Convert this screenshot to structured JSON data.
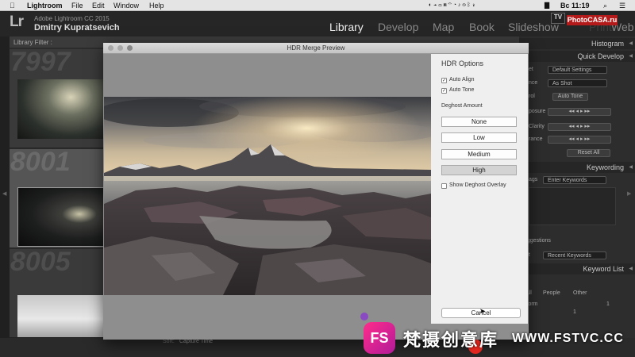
{
  "menubar": {
    "app": "Lightroom",
    "items": [
      "File",
      "Edit",
      "Window",
      "Help"
    ],
    "clock": "Вс 11:19",
    "flag_icon": "us-flag-icon"
  },
  "identity": {
    "logo": "Lr",
    "app_title": "Adobe Lightroom CC 2015",
    "user": "Dmitry Kupratsevich",
    "modules": [
      "Library",
      "Develop",
      "Map",
      "Book",
      "Slideshow",
      "Print",
      "Web"
    ],
    "active_module": "Library",
    "tv_badge": "TV",
    "watermark_top": "PhotoCASA.ru"
  },
  "left_panel": {
    "filter_label": "Library Filter :",
    "cells": [
      {
        "number": "7997"
      },
      {
        "number": "8001"
      },
      {
        "number": "8005"
      }
    ]
  },
  "dialog": {
    "title": "HDR Merge Preview",
    "options_heading": "HDR Options",
    "auto_align": {
      "label": "Auto Align",
      "checked": true
    },
    "auto_tone": {
      "label": "Auto Tone",
      "checked": true
    },
    "deghost_label": "Deghost Amount",
    "deghost_options": [
      "None",
      "Low",
      "Medium",
      "High"
    ],
    "deghost_selected": "High",
    "show_overlay": {
      "label": "Show Deghost Overlay",
      "checked": false
    },
    "cancel_label": "Cancel"
  },
  "right_panel": {
    "histogram": "Histogram",
    "quick_develop": "Quick Develop",
    "preset_label": "et",
    "preset_value": "Default Settings",
    "wb_label": "nce",
    "wb_value": "As Shot",
    "tone_label": "rol",
    "auto_tone_btn": "Auto Tone",
    "exposure_label": "posure",
    "clarity_label": "Clarity",
    "vibrance_label": "rance",
    "reset_all": "Reset All",
    "keywording": "Keywording",
    "tags_label": "ags",
    "tags_value": "Enter Keywords",
    "suggestions": "uggestions",
    "set_label": "et",
    "set_value": "Recent Keywords",
    "keyword_list": "Keyword List",
    "kw_tabs": [
      "All",
      "People",
      "Other"
    ],
    "kw_item": "storm",
    "kw_count": "1",
    "kw_count_2": "1"
  },
  "toolbar": {
    "sort_label": "Sort:",
    "sort_value": "Capture Time",
    "page_num": "11"
  },
  "branding": {
    "logo_letters": "FS",
    "chinese": "梵摄创意库",
    "url": "WWW.FSTVC.CC"
  },
  "colors": {
    "brand_gradient_start": "#ff2d8a",
    "brand_gradient_end": "#b21a9a",
    "watermark_red": "#b41a1a"
  }
}
